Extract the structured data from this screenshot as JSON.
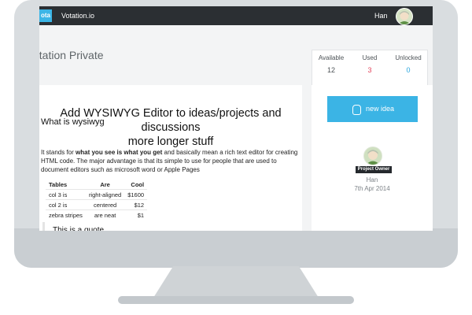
{
  "topbar": {
    "logo_text": "ota",
    "brand": "Votation.io",
    "user_name": "Han"
  },
  "header": {
    "title": "otation Private"
  },
  "stats": {
    "available_label": "Available",
    "available_value": "12",
    "used_label": "Used",
    "used_value": "3",
    "unlocked_label": "Unlocked",
    "unlocked_value": "0",
    "colors": {
      "default": "#4c5256",
      "used": "#e3455c",
      "unlocked": "#2aa6de"
    }
  },
  "idea": {
    "title_line1": "Add WYSIWYG Editor to ideas/projects and discussions",
    "title_line2": "more longer stuff",
    "section_title": "What is wysiwyg",
    "para_prefix": "It stands for ",
    "para_bold": "what you see is what you get",
    "para_suffix": " and basically mean a rich text editor for creating HTML code. The major advantage is that its simple to use for people that are used to document editors such as microsoft word or Apple Pages",
    "table": {
      "headers": [
        "Tables",
        "Are",
        "Cool"
      ],
      "rows": [
        [
          "col 3 is",
          "right-aligned",
          "$1600"
        ],
        [
          "col 2 is",
          "centered",
          "$12"
        ],
        [
          "zebra stripes",
          "are neat",
          "$1"
        ]
      ]
    },
    "quote": "This is a quote"
  },
  "sidebar": {
    "new_idea_label": "new idea",
    "owner_badge": "Project Owner",
    "owner_name": "Han",
    "owner_date": "7th Apr 2014",
    "accent": "#3bb4e5"
  },
  "icons": [
    "lightbulb-icon",
    "avatar-icon"
  ]
}
